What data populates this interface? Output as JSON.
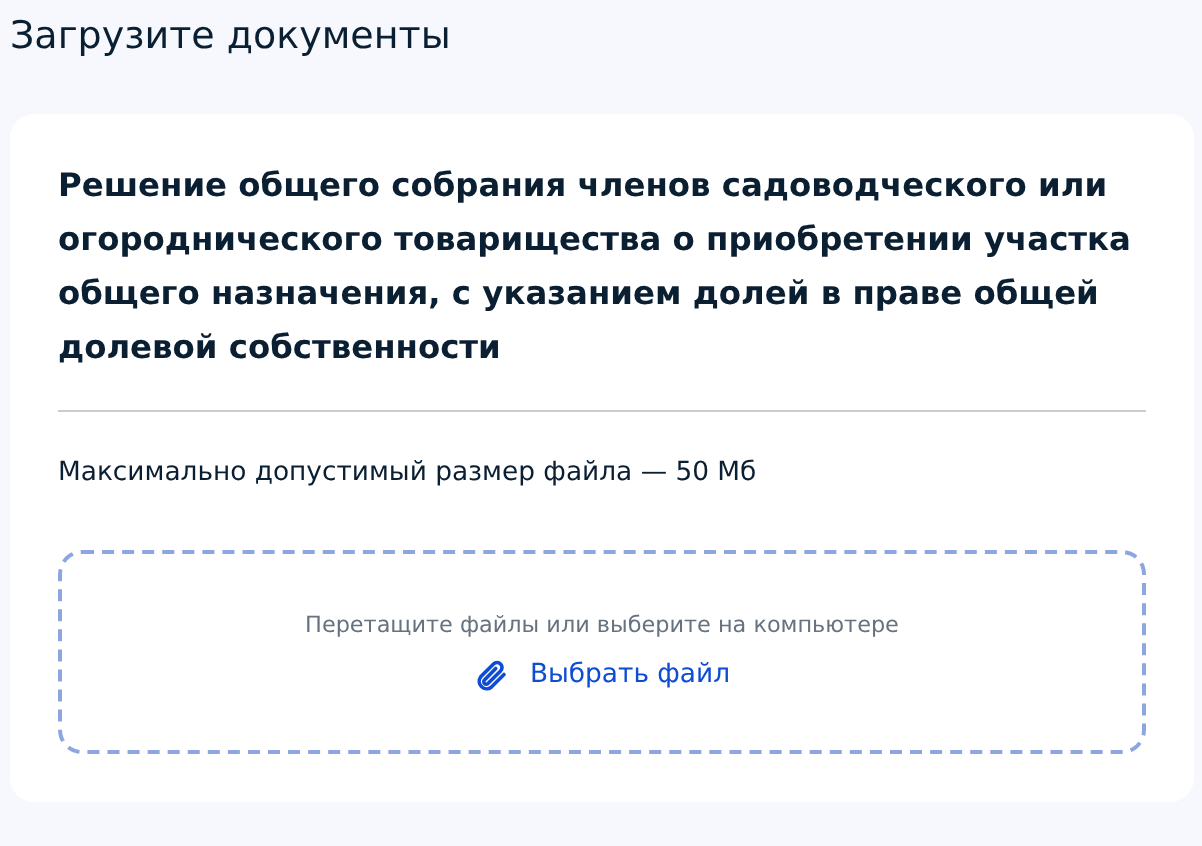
{
  "page_title": "Загрузите документы",
  "document": {
    "title": "Решение общего собрания членов садоводческого или огороднического товарищества о приобретении участка общего назначения, с указанием долей в праве общей долевой собственности",
    "size_note": "Максимально допустимый размер файла — 50 Мб",
    "dropzone": {
      "hint": "Перетащите файлы или выберите на компьютере",
      "link": "Выбрать файл"
    }
  }
}
